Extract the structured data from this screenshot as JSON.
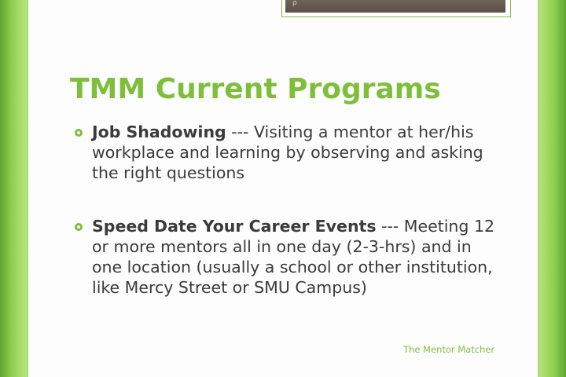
{
  "colors": {
    "accent": "#7ebf3a",
    "text": "#3b3b3b",
    "slide_background": "#fdfdfd",
    "side_band": "#8ccc4f"
  },
  "slide": {
    "title": "TMM Current Programs",
    "bullets": [
      {
        "heading": "Job Shadowing",
        "separator": " --- ",
        "text": "Visiting a mentor at her/his workplace and learning by observing and asking the right questions"
      },
      {
        "heading": "Speed Date Your Career Events",
        "separator": " --- ",
        "text": "Meeting 12 or more mentors all in one day (2-3-hrs) and in one location (usually a school or other institution, like Mercy Street or SMU Campus)"
      }
    ],
    "footer": "The Mentor Matcher",
    "bullet_icon": "circle-bullet-icon"
  }
}
